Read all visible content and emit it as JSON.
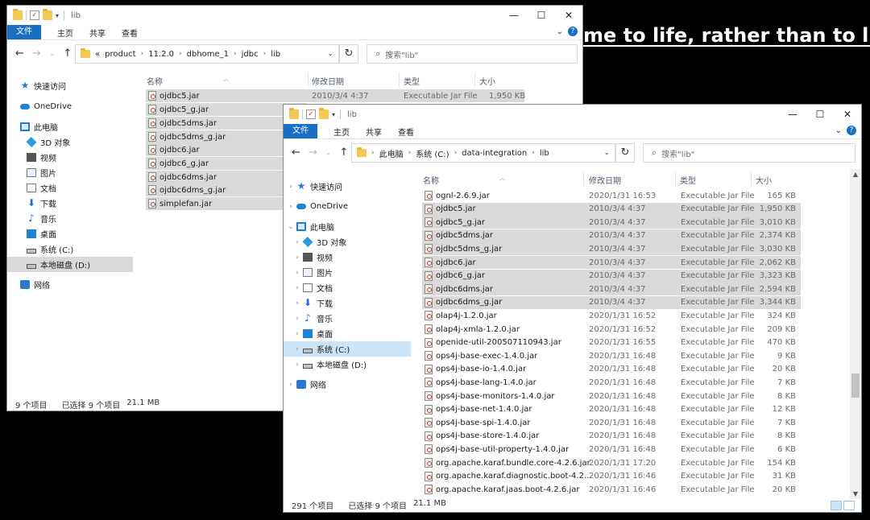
{
  "background_text": "me to life, rather than to life",
  "window_back": {
    "title": "lib",
    "ribbon_tabs": [
      "文件",
      "主页",
      "共享",
      "查看"
    ],
    "breadcrumb_prefix": "«",
    "breadcrumb": [
      "product",
      "11.2.0",
      "dbhome_1",
      "jdbc",
      "lib"
    ],
    "search_placeholder": "搜索\"lib\"",
    "nav_items": [
      {
        "label": "快速访问",
        "icon": "star-icon"
      },
      {
        "label": "OneDrive",
        "icon": "cloud-icon"
      },
      {
        "label": "此电脑",
        "icon": "computer-icon"
      },
      {
        "label": "3D 对象",
        "icon": "cube-icon"
      },
      {
        "label": "视频",
        "icon": "video-icon"
      },
      {
        "label": "图片",
        "icon": "picture-icon"
      },
      {
        "label": "文档",
        "icon": "document-icon"
      },
      {
        "label": "下载",
        "icon": "download-icon"
      },
      {
        "label": "音乐",
        "icon": "music-icon"
      },
      {
        "label": "桌面",
        "icon": "desktop-icon"
      },
      {
        "label": "系统 (C:)",
        "icon": "drive-icon"
      },
      {
        "label": "本地磁盘 (D:)",
        "icon": "drive-icon"
      },
      {
        "label": "网络",
        "icon": "network-icon"
      }
    ],
    "columns": [
      "名称",
      "修改日期",
      "类型",
      "大小"
    ],
    "files": [
      {
        "name": "ojdbc5.jar",
        "date": "2010/3/4 4:37",
        "type": "Executable Jar File",
        "size": "1,950 KB"
      },
      {
        "name": "ojdbc5_g.jar",
        "date": "",
        "type": "",
        "size": ""
      },
      {
        "name": "ojdbc5dms.jar",
        "date": "",
        "type": "",
        "size": ""
      },
      {
        "name": "ojdbc5dms_g.jar",
        "date": "",
        "type": "",
        "size": ""
      },
      {
        "name": "ojdbc6.jar",
        "date": "",
        "type": "",
        "size": ""
      },
      {
        "name": "ojdbc6_g.jar",
        "date": "",
        "type": "",
        "size": ""
      },
      {
        "name": "ojdbc6dms.jar",
        "date": "",
        "type": "",
        "size": ""
      },
      {
        "name": "ojdbc6dms_g.jar",
        "date": "",
        "type": "",
        "size": ""
      },
      {
        "name": "simplefan.jar",
        "date": "",
        "type": "",
        "size": ""
      }
    ],
    "status": {
      "count": "9 个项目",
      "selected": "已选择 9 个项目",
      "size": "21.1 MB"
    }
  },
  "window_front": {
    "title": "lib",
    "ribbon_tabs": [
      "文件",
      "主页",
      "共享",
      "查看"
    ],
    "breadcrumb": [
      "此电脑",
      "系统 (C:)",
      "data-integration",
      "lib"
    ],
    "search_placeholder": "搜索\"lib\"",
    "nav_items": [
      {
        "label": "快速访问",
        "icon": "star-icon"
      },
      {
        "label": "OneDrive",
        "icon": "cloud-icon"
      },
      {
        "label": "此电脑",
        "icon": "computer-icon"
      },
      {
        "label": "3D 对象",
        "icon": "cube-icon"
      },
      {
        "label": "视频",
        "icon": "video-icon"
      },
      {
        "label": "图片",
        "icon": "picture-icon"
      },
      {
        "label": "文档",
        "icon": "document-icon"
      },
      {
        "label": "下载",
        "icon": "download-icon"
      },
      {
        "label": "音乐",
        "icon": "music-icon"
      },
      {
        "label": "桌面",
        "icon": "desktop-icon"
      },
      {
        "label": "系统 (C:)",
        "icon": "drive-icon"
      },
      {
        "label": "本地磁盘 (D:)",
        "icon": "drive-icon"
      },
      {
        "label": "网络",
        "icon": "network-icon"
      }
    ],
    "columns": [
      "名称",
      "修改日期",
      "类型",
      "大小"
    ],
    "files": [
      {
        "name": "ognl-2.6.9.jar",
        "date": "2020/1/31 16:53",
        "type": "Executable Jar File",
        "size": "165 KB",
        "selected": false
      },
      {
        "name": "ojdbc5.jar",
        "date": "2010/3/4 4:37",
        "type": "Executable Jar File",
        "size": "1,950 KB",
        "selected": true
      },
      {
        "name": "ojdbc5_g.jar",
        "date": "2010/3/4 4:37",
        "type": "Executable Jar File",
        "size": "3,010 KB",
        "selected": true
      },
      {
        "name": "ojdbc5dms.jar",
        "date": "2010/3/4 4:37",
        "type": "Executable Jar File",
        "size": "2,374 KB",
        "selected": true
      },
      {
        "name": "ojdbc5dms_g.jar",
        "date": "2010/3/4 4:37",
        "type": "Executable Jar File",
        "size": "3,030 KB",
        "selected": true
      },
      {
        "name": "ojdbc6.jar",
        "date": "2010/3/4 4:37",
        "type": "Executable Jar File",
        "size": "2,062 KB",
        "selected": true
      },
      {
        "name": "ojdbc6_g.jar",
        "date": "2010/3/4 4:37",
        "type": "Executable Jar File",
        "size": "3,323 KB",
        "selected": true
      },
      {
        "name": "ojdbc6dms.jar",
        "date": "2010/3/4 4:37",
        "type": "Executable Jar File",
        "size": "2,594 KB",
        "selected": true
      },
      {
        "name": "ojdbc6dms_g.jar",
        "date": "2010/3/4 4:37",
        "type": "Executable Jar File",
        "size": "3,344 KB",
        "selected": true
      },
      {
        "name": "olap4j-1.2.0.jar",
        "date": "2020/1/31 16:52",
        "type": "Executable Jar File",
        "size": "324 KB",
        "selected": false
      },
      {
        "name": "olap4j-xmla-1.2.0.jar",
        "date": "2020/1/31 16:52",
        "type": "Executable Jar File",
        "size": "209 KB",
        "selected": false
      },
      {
        "name": "openide-util-200507110943.jar",
        "date": "2020/1/31 16:55",
        "type": "Executable Jar File",
        "size": "470 KB",
        "selected": false
      },
      {
        "name": "ops4j-base-exec-1.4.0.jar",
        "date": "2020/1/31 16:48",
        "type": "Executable Jar File",
        "size": "9 KB",
        "selected": false
      },
      {
        "name": "ops4j-base-io-1.4.0.jar",
        "date": "2020/1/31 16:48",
        "type": "Executable Jar File",
        "size": "20 KB",
        "selected": false
      },
      {
        "name": "ops4j-base-lang-1.4.0.jar",
        "date": "2020/1/31 16:48",
        "type": "Executable Jar File",
        "size": "7 KB",
        "selected": false
      },
      {
        "name": "ops4j-base-monitors-1.4.0.jar",
        "date": "2020/1/31 16:48",
        "type": "Executable Jar File",
        "size": "8 KB",
        "selected": false
      },
      {
        "name": "ops4j-base-net-1.4.0.jar",
        "date": "2020/1/31 16:48",
        "type": "Executable Jar File",
        "size": "12 KB",
        "selected": false
      },
      {
        "name": "ops4j-base-spi-1.4.0.jar",
        "date": "2020/1/31 16:48",
        "type": "Executable Jar File",
        "size": "7 KB",
        "selected": false
      },
      {
        "name": "ops4j-base-store-1.4.0.jar",
        "date": "2020/1/31 16:48",
        "type": "Executable Jar File",
        "size": "8 KB",
        "selected": false
      },
      {
        "name": "ops4j-base-util-property-1.4.0.jar",
        "date": "2020/1/31 16:48",
        "type": "Executable Jar File",
        "size": "6 KB",
        "selected": false
      },
      {
        "name": "org.apache.karaf.bundle.core-4.2.6.jar",
        "date": "2020/1/31 17:20",
        "type": "Executable Jar File",
        "size": "154 KB",
        "selected": false
      },
      {
        "name": "org.apache.karaf.diagnostic.boot-4.2...",
        "date": "2020/1/31 16:46",
        "type": "Executable Jar File",
        "size": "31 KB",
        "selected": false
      },
      {
        "name": "org.apache.karaf.jaas.boot-4.2.6.jar",
        "date": "2020/1/31 16:46",
        "type": "Executable Jar File",
        "size": "20 KB",
        "selected": false
      }
    ],
    "status": {
      "count": "291 个项目",
      "selected": "已选择 9 个项目",
      "size": "21.1 MB"
    }
  }
}
